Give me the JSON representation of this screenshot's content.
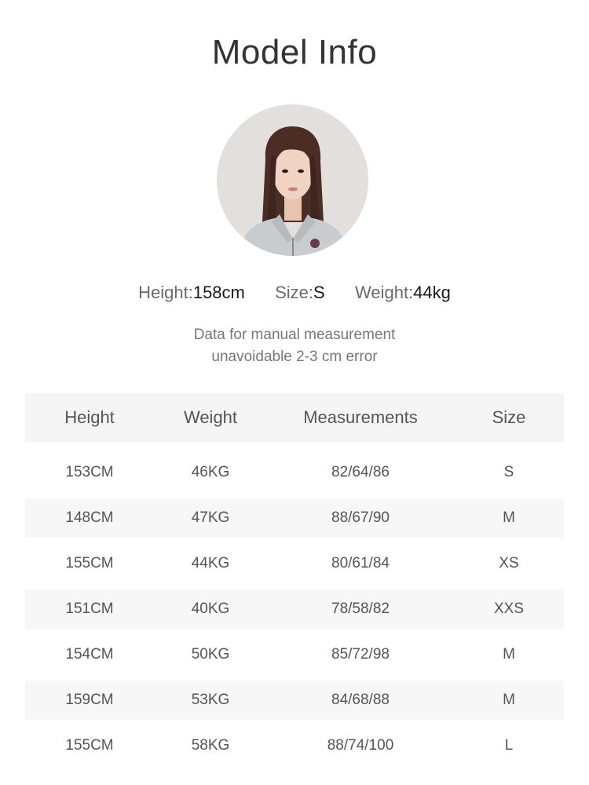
{
  "title": "Model Info",
  "model": {
    "height_label": "Height:",
    "height_value": "158cm",
    "size_label": "Size:",
    "size_value": "S",
    "weight_label": "Weight:",
    "weight_value": "44kg"
  },
  "note": {
    "line1": "Data for manual measurement",
    "line2": "unavoidable 2-3 cm error"
  },
  "table": {
    "headers": [
      "Height",
      "Weight",
      "Measurements",
      "Size"
    ],
    "rows": [
      [
        "153CM",
        "46KG",
        "82/64/86",
        "S"
      ],
      [
        "148CM",
        "47KG",
        "88/67/90",
        "M"
      ],
      [
        "155CM",
        "44KG",
        "80/61/84",
        "XS"
      ],
      [
        "151CM",
        "40KG",
        "78/58/82",
        "XXS"
      ],
      [
        "154CM",
        "50KG",
        "85/72/98",
        "M"
      ],
      [
        "159CM",
        "53KG",
        "84/68/88",
        "M"
      ],
      [
        "155CM",
        "58KG",
        "88/74/100",
        "L"
      ]
    ]
  },
  "colors": {
    "header_bg": "#f5f5f5",
    "row_shade": "#f7f7f7",
    "title": "#333333"
  }
}
